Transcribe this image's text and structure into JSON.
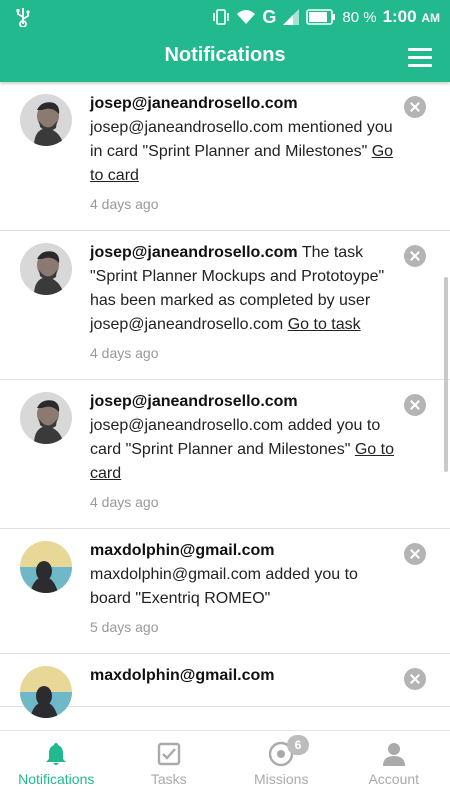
{
  "status_bar": {
    "battery": "80 %",
    "time": "1:00",
    "ampm": "AM",
    "network": "G"
  },
  "header": {
    "title": "Notifications"
  },
  "notifications": [
    {
      "user": "josep@janeandrosello.com",
      "message": "josep@janeandrosello.com mentioned you in card \"Sprint Planner and Milestones\"",
      "link": "Go to card",
      "time": "4 days ago"
    },
    {
      "user": "josep@janeandrosello.com",
      "message": "The task \"Sprint Planner Mockups and Prototoype\" has been marked as completed by user josep@janeandrosello.com",
      "link": "Go to task",
      "time": "4 days ago"
    },
    {
      "user": "josep@janeandrosello.com",
      "message": "josep@janeandrosello.com added you to card \"Sprint Planner and Milestones\"",
      "link": "Go to card",
      "time": "4 days ago"
    },
    {
      "user": "maxdolphin@gmail.com",
      "message": "maxdolphin@gmail.com added you to board \"Exentriq ROMEO\"",
      "link": "",
      "time": "5 days ago"
    },
    {
      "user": "maxdolphin@gmail.com",
      "message": "",
      "link": "",
      "time": ""
    }
  ],
  "bottom_nav": [
    {
      "label": "Notifications",
      "icon": "bell-icon",
      "active": true
    },
    {
      "label": "Tasks",
      "icon": "checkbox-icon",
      "active": false
    },
    {
      "label": "Missions",
      "icon": "missions-icon",
      "badge": "6",
      "active": false
    },
    {
      "label": "Account",
      "icon": "person-icon",
      "active": false
    }
  ],
  "colors": {
    "accent": "#22b98e",
    "inactive": "#aaaaaa",
    "close": "#b4b4b4"
  }
}
